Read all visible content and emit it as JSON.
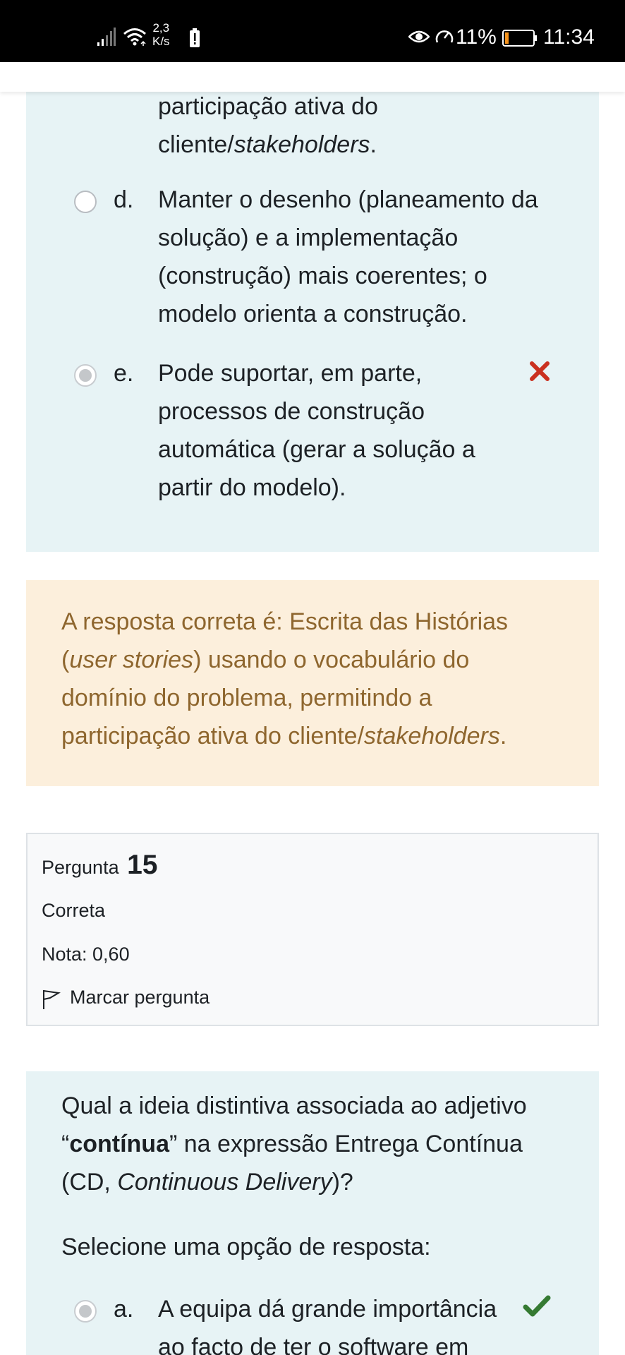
{
  "status_bar": {
    "network_speed_value": "2,3",
    "network_speed_unit": "K/s",
    "battery_percent": "11%",
    "time": "11:34",
    "icons": [
      "signal-icon",
      "wifi-icon",
      "battery-alert-icon",
      "eye-icon",
      "gauge-icon",
      "battery-icon"
    ]
  },
  "previous_question": {
    "option_c_tail_line1": "participação ativa do",
    "option_c_tail_line2": "cliente/",
    "option_c_tail_line2_italic": "stakeholders",
    "option_c_tail_line2_end": ".",
    "options": [
      {
        "letter": "d.",
        "lines": [
          "Manter o desenho (planeamento da",
          "solução) e a implementação",
          "(construção) mais coerentes; o",
          "modelo orienta a construção."
        ],
        "selected": false
      },
      {
        "letter": "e.",
        "lines": [
          "Pode suportar, em parte,",
          "processos de construção",
          "automática (gerar a solução a",
          "partir do modelo)."
        ],
        "selected": true,
        "result_icon": "incorrect-x-icon"
      }
    ],
    "feedback": {
      "line1": "A resposta correta é: Escrita das Histórias",
      "line2_open": "(",
      "line2_italic": "user stories",
      "line2_rest": ") usando o vocabulário do",
      "line3": "domínio do problema, permitindo a",
      "line4_start": "participação ativa do cliente/",
      "line4_italic": "stakeholders",
      "line4_end": "."
    }
  },
  "question_info": {
    "label": "Pergunta",
    "number": "15",
    "state": "Correta",
    "grade": "Nota: 0,60",
    "flag_label": "Marcar pergunta"
  },
  "question": {
    "line1": "Qual a ideia distintiva associada ao adjetivo",
    "line2_open": "“",
    "line2_bold": "contínua",
    "line2_rest": "” na expressão Entrega Contínua",
    "line3_start": "(CD, ",
    "line3_italic": "Continuous Delivery",
    "line3_end": ")?",
    "prompt": "Selecione uma opção de resposta:",
    "options": [
      {
        "letter": "a.",
        "lines": [
          "A equipa dá grande importância",
          "ao facto de ter o software em"
        ],
        "selected": true,
        "result_icon": "correct-check-icon"
      }
    ]
  },
  "colors": {
    "answer_bg": "#e7f3f5",
    "feedback_bg": "#fcefdc",
    "feedback_text": "#8e662e",
    "incorrect": "#ca3120",
    "correct": "#357a32"
  }
}
